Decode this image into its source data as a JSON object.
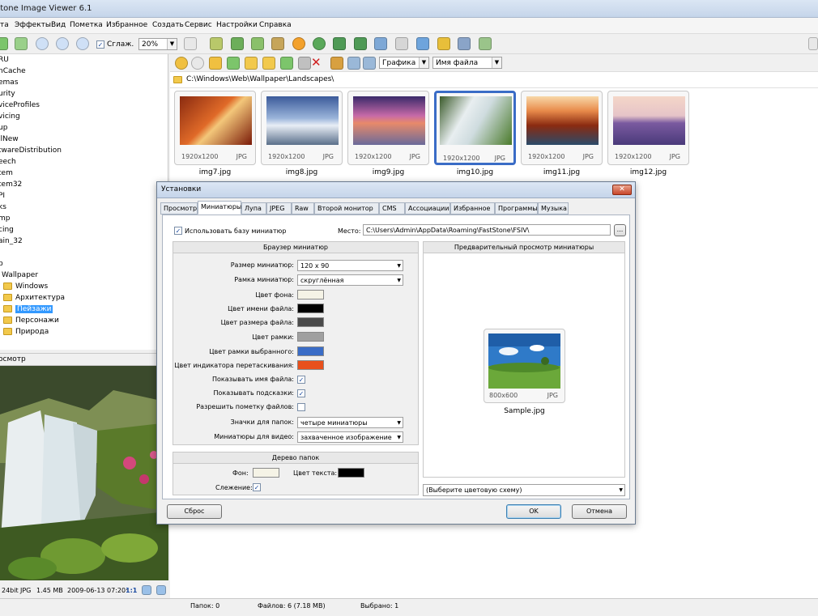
{
  "window": {
    "title": "stone Image Viewer 6.1"
  },
  "menu": [
    "та",
    "Эффекты",
    "Вид",
    "Пометка",
    "Избранное",
    "Создать",
    "Сервис",
    "Настройки",
    "Справка"
  ],
  "toolbar": {
    "smooth_label": "Сглаж.",
    "zoom": "20%"
  },
  "browser_toolbar": {
    "view_mode": "Графика",
    "sort": "Имя файла"
  },
  "path": "C:\\Windows\\Web\\Wallpaper\\Landscapes\\",
  "thumbnails": [
    {
      "name": "img7.jpg",
      "dim": "1920x1200",
      "fmt": "JPG"
    },
    {
      "name": "img8.jpg",
      "dim": "1920x1200",
      "fmt": "JPG"
    },
    {
      "name": "img9.jpg",
      "dim": "1920x1200",
      "fmt": "JPG"
    },
    {
      "name": "img10.jpg",
      "dim": "1920x1200",
      "fmt": "JPG"
    },
    {
      "name": "img11.jpg",
      "dim": "1920x1200",
      "fmt": "JPG"
    },
    {
      "name": "img12.jpg",
      "dim": "1920x1200",
      "fmt": "JPG"
    }
  ],
  "tree": [
    "RU",
    "nCache",
    "emas",
    "urity",
    "viceProfiles",
    "vicing",
    "up",
    "llNew",
    "twareDistribution",
    "eech",
    "tem",
    "tem32",
    "PI",
    "ks",
    "mp",
    "cing",
    "ain_32",
    "",
    "b",
    "Wallpaper",
    "Windows",
    "Архитектура",
    "Пейзажи",
    "Персонажи",
    "Природа"
  ],
  "preview": {
    "header": "осмотр",
    "info": [
      "24bit",
      "JPG",
      "1.45 MB",
      "2009-06-13 07:20:",
      "1:1"
    ]
  },
  "status": {
    "folders": "Папок: 0",
    "files": "Файлов: 6 (7.18 MB)",
    "selected": "Выбрано: 1"
  },
  "dialog": {
    "title": "Установки",
    "tabs": [
      "Просмотр",
      "Миниатюры",
      "Лупа",
      "JPEG",
      "Raw",
      "Второй монитор",
      "CMS",
      "Ассоциации",
      "Избранное",
      "Программы",
      "Музыка"
    ],
    "use_db_label": "Использовать базу миниатюр",
    "place_label": "Место:",
    "place_value": "C:\\Users\\Admin\\AppData\\Roaming\\FastStone\\FSIV\\",
    "browse_btn": "...",
    "browser_group": "Браузер миниатюр",
    "size_label": "Размер миниатюр:",
    "size_value": "120 x 90",
    "frame_label": "Рамка миниатюр:",
    "frame_value": "скруглённая",
    "bg_label": "Цвет фона:",
    "fname_color_label": "Цвет имени файла:",
    "fsize_color_label": "Цвет размера файла:",
    "frame_color_label": "Цвет рамки:",
    "sel_frame_color_label": "Цвет рамки выбранного:",
    "drag_color_label": "Цвет индикатора перетаскивания:",
    "show_name_label": "Показывать имя файла:",
    "show_hints_label": "Показывать подсказки:",
    "allow_mark_label": "Разрешить пометку файлов:",
    "folder_icons_label": "Значки для папок:",
    "folder_icons_value": "четыре миниатюры",
    "video_label": "Миниатюры для видео:",
    "video_value": "захваченное изображение",
    "tree_group": "Дерево папок",
    "tree_bg_label": "Фон:",
    "tree_text_label": "Цвет текста:",
    "tracking_label": "Слежение:",
    "preview_group": "Предварительный просмотр миниатюры",
    "sample_dim": "800x600",
    "sample_fmt": "JPG",
    "sample_name": "Sample.jpg",
    "scheme": "(Выберите цветовую схему)",
    "reset": "Сброс",
    "ok": "OK",
    "cancel": "Отмена",
    "colors": {
      "bg": "#f5f3e6",
      "name": "#000000",
      "size": "#4a4a4a",
      "frame": "#a0a0a0",
      "selected": "#3a6cc6",
      "drag": "#e8501c",
      "tree_bg": "#f5f3e6",
      "tree_text": "#000000"
    }
  }
}
